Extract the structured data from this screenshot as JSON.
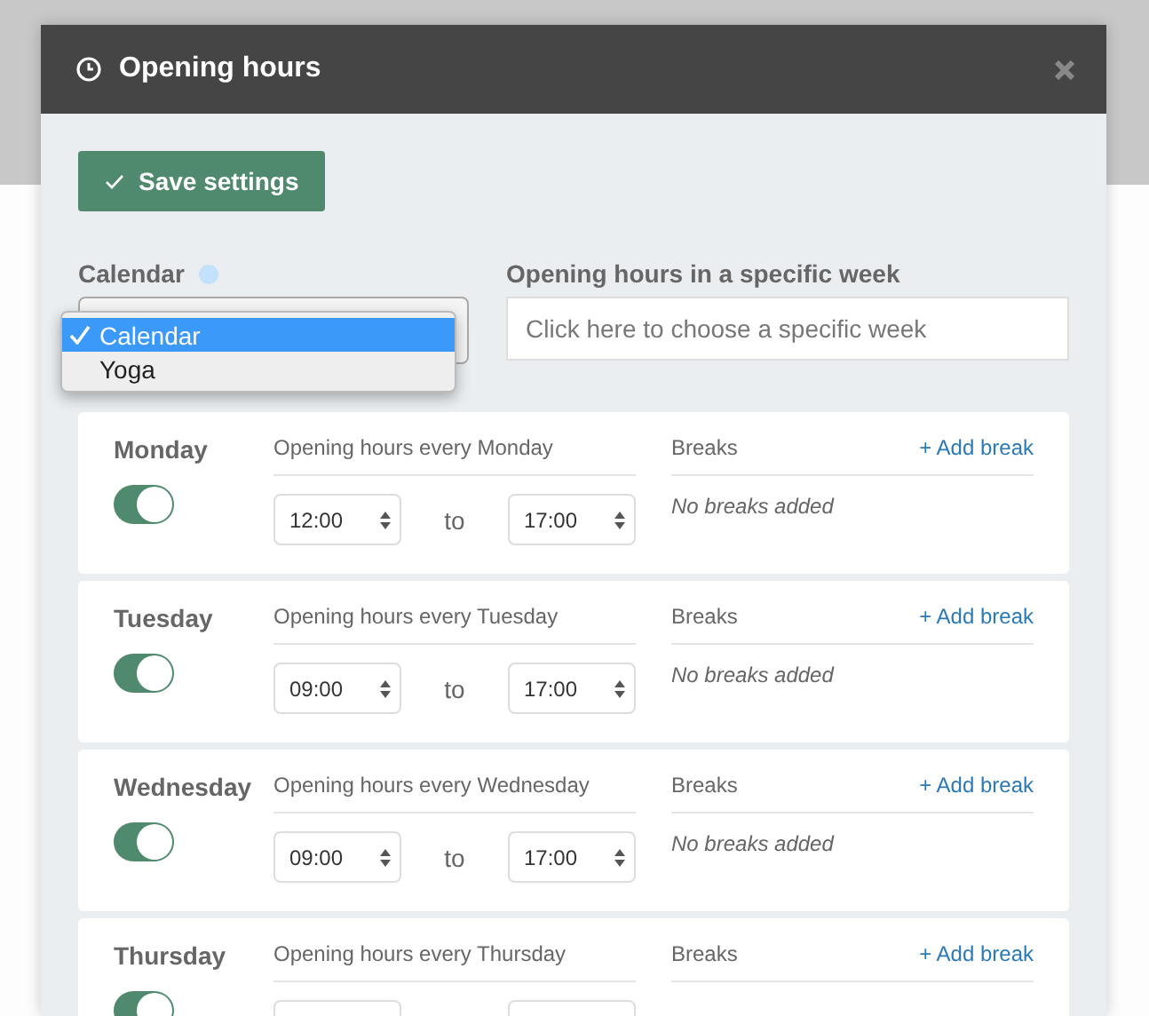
{
  "modal": {
    "title": "Opening hours",
    "save_button": "Save settings",
    "calendar": {
      "label": "Calendar",
      "options": [
        {
          "label": "Calendar",
          "selected": true
        },
        {
          "label": "Yoga",
          "selected": false
        }
      ]
    },
    "week": {
      "label": "Opening hours in a specific week",
      "placeholder": "Click here to choose a specific week"
    },
    "days": [
      {
        "name": "Monday",
        "on": true,
        "hours_label": "Opening hours every Monday",
        "from": "12:00",
        "to_word": "to",
        "to": "17:00",
        "breaks_label": "Breaks",
        "add_break": "+ Add break",
        "breaks_text": "No breaks added"
      },
      {
        "name": "Tuesday",
        "on": true,
        "hours_label": "Opening hours every Tuesday",
        "from": "09:00",
        "to_word": "to",
        "to": "17:00",
        "breaks_label": "Breaks",
        "add_break": "+ Add break",
        "breaks_text": "No breaks added"
      },
      {
        "name": "Wednesday",
        "on": true,
        "hours_label": "Opening hours every Wednesday",
        "from": "09:00",
        "to_word": "to",
        "to": "17:00",
        "breaks_label": "Breaks",
        "add_break": "+ Add break",
        "breaks_text": "No breaks added"
      },
      {
        "name": "Thursday",
        "on": true,
        "hours_label": "Opening hours every Thursday",
        "breaks_label": "Breaks",
        "add_break": "+ Add break"
      }
    ]
  }
}
